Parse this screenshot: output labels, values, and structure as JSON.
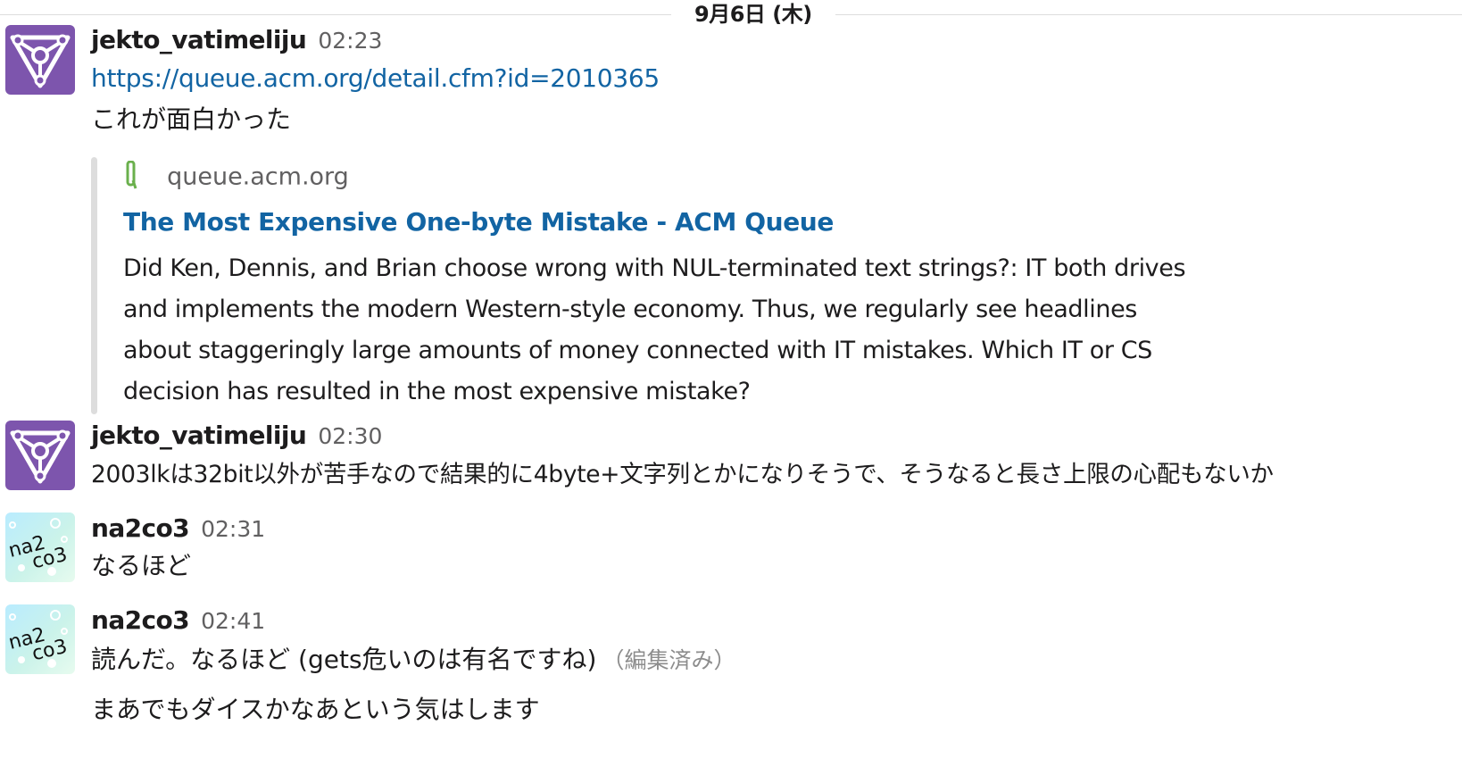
{
  "day_divider": "9月6日 (木)",
  "messages": [
    {
      "user": "jekto_vatimeliju",
      "time": "02:23",
      "link": "https://queue.acm.org/detail.cfm?id=2010365",
      "text": "これが面白かった",
      "attachment": {
        "service": "queue.acm.org",
        "title": "The Most Expensive One-byte Mistake - ACM Queue",
        "description": "Did Ken, Dennis, and Brian choose wrong with NUL-terminated text strings?: IT both drives and implements the modern Western-style economy. Thus, we regularly see headlines about staggeringly large amounts of money connected with IT mistakes. Which IT or CS decision has resulted in the most expensive mistake?"
      }
    },
    {
      "user": "jekto_vatimeliju",
      "time": "02:30",
      "text": "2003lkは32bit以外が苦手なので結果的に4byte+文字列とかになりそうで、そうなると長さ上限の心配もないか"
    },
    {
      "user": "na2co3",
      "time": "02:31",
      "text": "なるほど"
    },
    {
      "user": "na2co3",
      "time": "02:41",
      "text": "読んだ。なるほど (gets危いのは有名ですね)",
      "edited_label": "（編集済み）",
      "text2": "まあでもダイスかなあという気はします"
    }
  ],
  "avatars": {
    "jekto": {
      "icon": "triangle-emblem-icon",
      "color": "#7d55ad"
    },
    "na2co3": {
      "lines": [
        "na2",
        "co3"
      ],
      "color": "#b9ecff"
    }
  },
  "colors": {
    "link": "#1264a3",
    "text": "#1d1c1d",
    "muted": "#616061",
    "quote_bar": "#dddddd"
  }
}
